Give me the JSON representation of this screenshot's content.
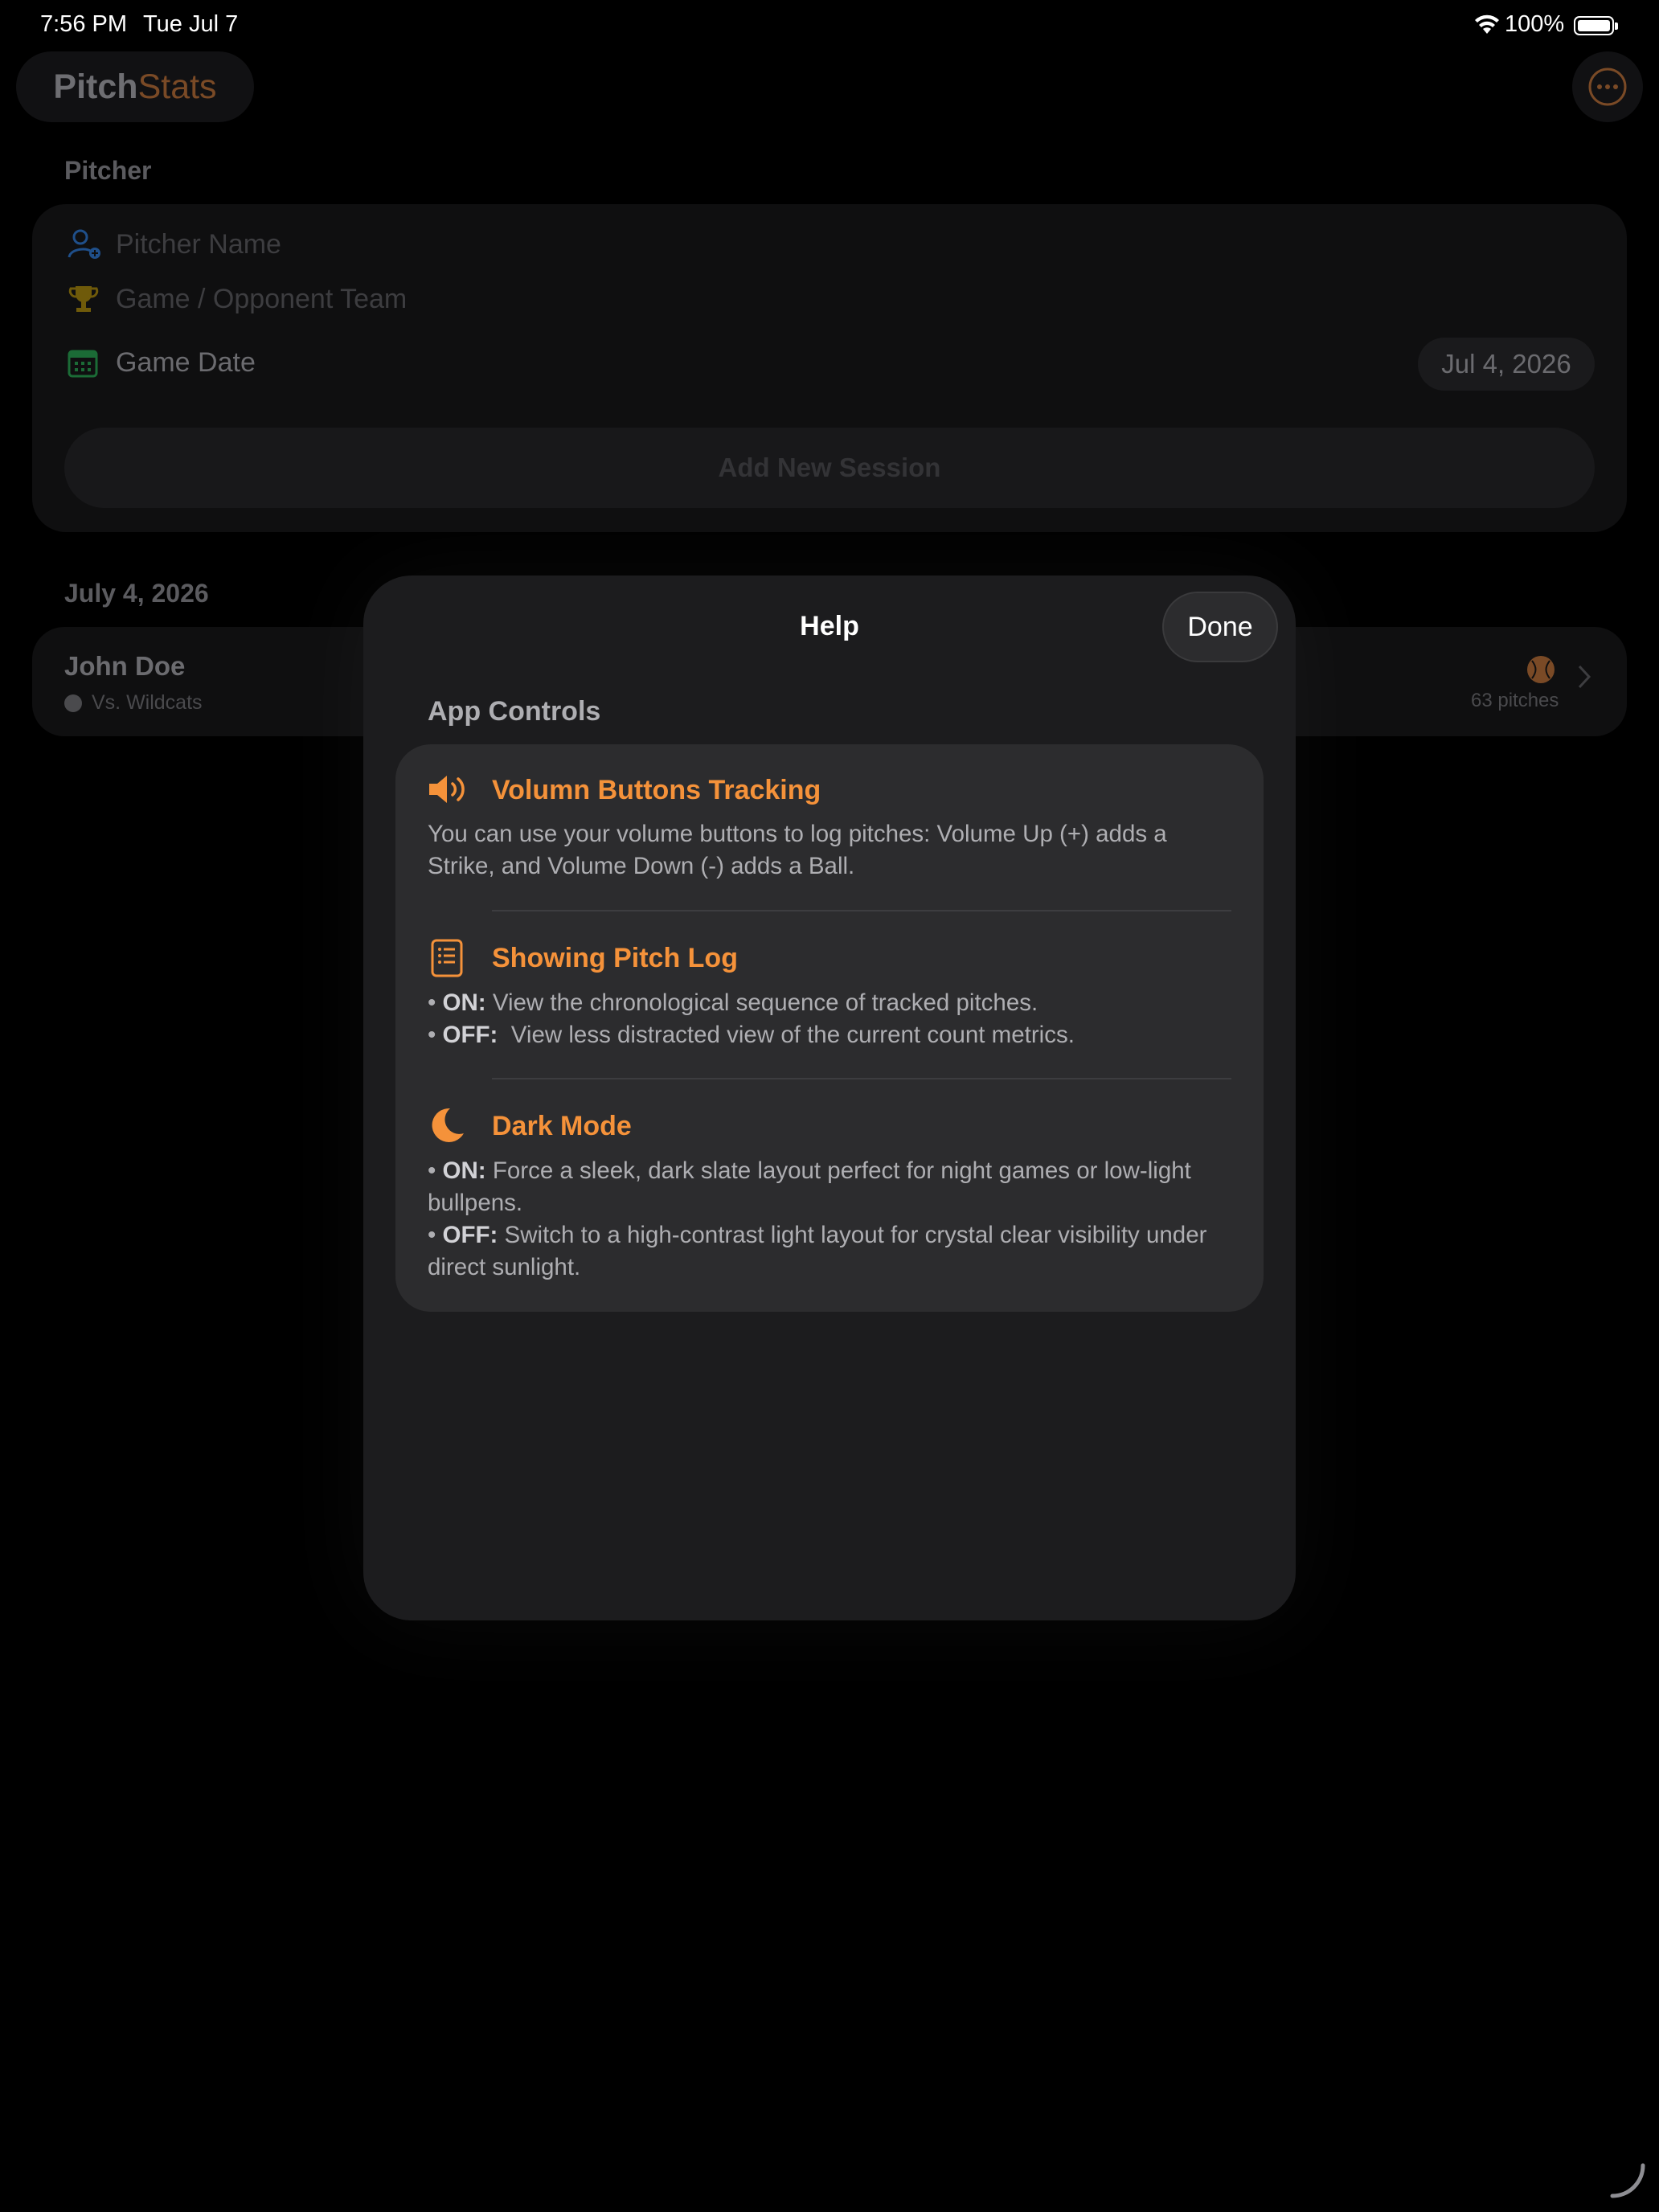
{
  "status_bar": {
    "time": "7:56 PM",
    "date": "Tue Jul 7",
    "battery": "100%"
  },
  "app": {
    "logo_pitch": "Pitch",
    "logo_stats": "Stats"
  },
  "form": {
    "section_label": "Pitcher",
    "pitcher_name_placeholder": "Pitcher Name",
    "game_placeholder": "Game / Opponent Team",
    "game_date_label": "Game Date",
    "game_date_value": "Jul 4, 2026",
    "add_session_label": "Add New Session"
  },
  "sessions": {
    "date_header": "July 4, 2026",
    "items": [
      {
        "name": "John Doe",
        "opponent": "Vs. Wildcats",
        "pitches": "63 pitches"
      }
    ]
  },
  "help": {
    "title": "Help",
    "done_label": "Done",
    "group_label": "App Controls",
    "items": [
      {
        "icon": "speaker-volume-icon",
        "title": "Volumn Buttons Tracking",
        "body": "You can use your volume buttons to log pitches: Volume Up (+) adds a Strike, and Volume Down (-) adds a Ball."
      },
      {
        "icon": "list-document-icon",
        "title": "Showing Pitch Log",
        "on_label": "ON:",
        "on_text": "View the chronological sequence of tracked pitches.",
        "off_label": "OFF:",
        "off_text": "View less distracted view of the current count metrics."
      },
      {
        "icon": "moon-icon",
        "title": "Dark Mode",
        "on_label": "ON:",
        "on_text": "Force a sleek, dark slate layout perfect for night games or low-light bullpens.",
        "off_label": "OFF:",
        "off_text": "Switch to a high-contrast light layout for crystal clear visibility under direct sunlight."
      }
    ]
  },
  "colors": {
    "accent": "#f5923a",
    "background": "#000000",
    "modal": "#1c1c1e",
    "card": "#2c2c2e"
  }
}
